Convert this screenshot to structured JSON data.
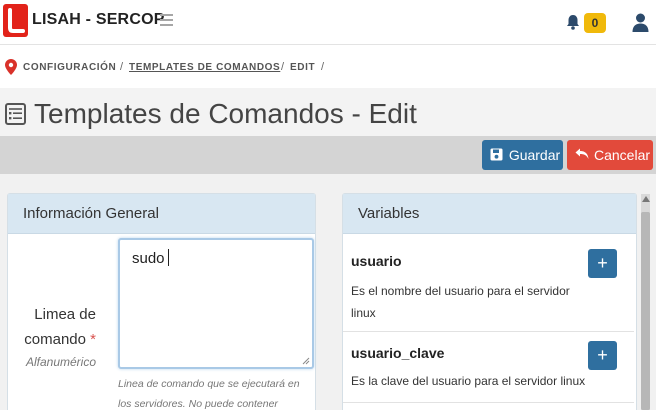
{
  "header": {
    "app_title": "LISAH - SERCOP",
    "notification_count": "0",
    "icons": {
      "logo": "app-logo",
      "menu": "hamburger-icon",
      "bell": "bell-icon",
      "user": "user-icon"
    },
    "brand_color": "#e2231a"
  },
  "breadcrumb": {
    "items": [
      "CONFIGURACIÓN",
      "TEMPLATES DE COMANDOS",
      "EDIT"
    ],
    "separator": "/"
  },
  "page": {
    "title": "Templates de Comandos - Edit"
  },
  "toolbar": {
    "save_label": "Guardar",
    "cancel_label": "Cancelar",
    "save_color": "#2f6f9f",
    "cancel_color": "#e24a3b"
  },
  "general": {
    "heading": "Información General",
    "command_label_line1": "Limea de",
    "command_label_line2": "comando",
    "required_mark": "*",
    "command_type": "Alfanumérico",
    "command_value": "sudo",
    "help_text": "Linea de comando que se ejecutará en los servidores. No puede contener"
  },
  "variables": {
    "heading": "Variables",
    "add_label": "+",
    "items": [
      {
        "name": "usuario",
        "description": "Es el nombre del usuario para el servidor linux"
      },
      {
        "name": "usuario_clave",
        "description": "Es la clave del usuario para el servidor linux"
      }
    ]
  }
}
